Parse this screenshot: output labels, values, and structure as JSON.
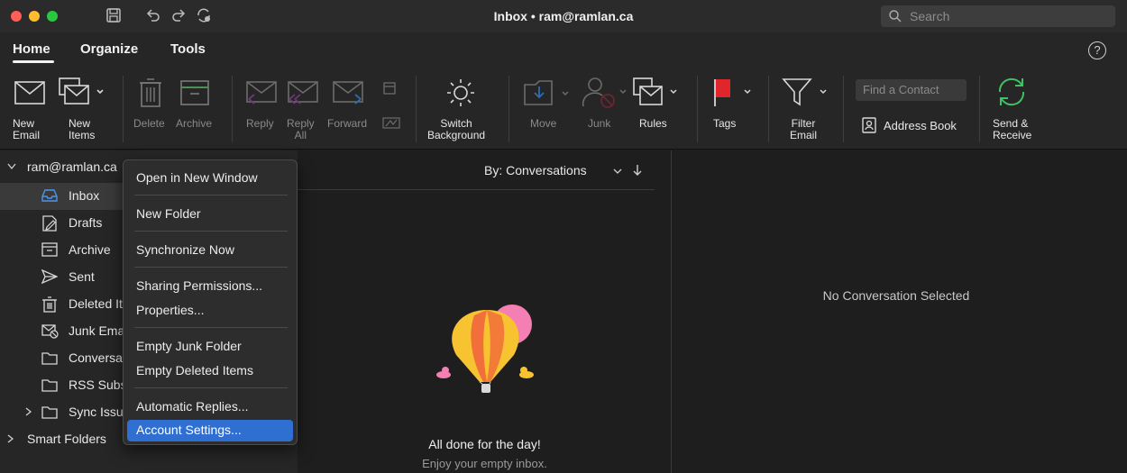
{
  "window": {
    "title": "Inbox • ram@ramlan.ca"
  },
  "search": {
    "placeholder": "Search"
  },
  "tabs": {
    "home": "Home",
    "organize": "Organize",
    "tools": "Tools"
  },
  "help_label": "?",
  "ribbon": {
    "new_email": "New\nEmail",
    "new_items": "New\nItems",
    "delete": "Delete",
    "archive": "Archive",
    "reply": "Reply",
    "reply_all": "Reply\nAll",
    "forward": "Forward",
    "switch_background": "Switch\nBackground",
    "move": "Move",
    "junk": "Junk",
    "rules": "Rules",
    "tags": "Tags",
    "filter_email": "Filter\nEmail",
    "find_contact_placeholder": "Find a Contact",
    "address_book": "Address Book",
    "send_receive": "Send &\nReceive"
  },
  "folders": {
    "account": "ram@ramlan.ca",
    "items": [
      "Inbox",
      "Drafts",
      "Archive",
      "Sent",
      "Deleted Items",
      "Junk Email",
      "Conversation History",
      "RSS Subscriptions",
      "Sync Issues"
    ],
    "smart_folders": "Smart Folders"
  },
  "message_list": {
    "sort": "By: Conversations",
    "empty_title": "All done for the day!",
    "empty_subtitle": "Enjoy your empty inbox."
  },
  "reading_pane": {
    "empty": "No Conversation Selected"
  },
  "context_menu": {
    "open_new_window": "Open in New Window",
    "new_folder": "New Folder",
    "synchronize_now": "Synchronize Now",
    "sharing_permissions": "Sharing Permissions...",
    "properties": "Properties...",
    "empty_junk": "Empty Junk Folder",
    "empty_deleted": "Empty Deleted Items",
    "automatic_replies": "Automatic Replies...",
    "account_settings": "Account Settings..."
  },
  "colors": {
    "accent": "#2f6fd1",
    "tag_flag": "#e0262b",
    "send_receive": "#3fc165",
    "balloon_yellow": "#f7c330",
    "balloon_orange": "#f26e3a",
    "balloon_pink": "#f47fb2"
  }
}
